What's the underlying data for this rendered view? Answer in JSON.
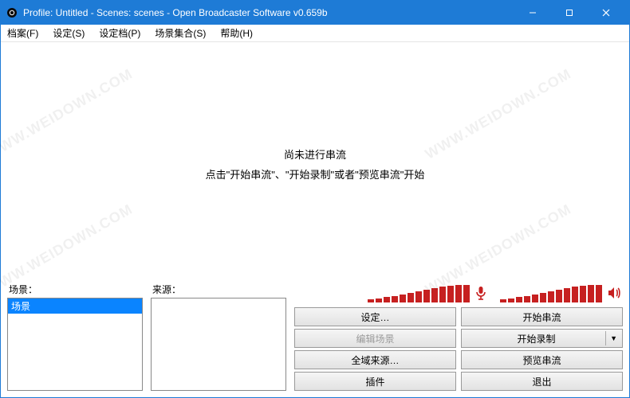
{
  "window": {
    "title": "Profile: Untitled - Scenes: scenes - Open Broadcaster Software v0.659b"
  },
  "menu": {
    "file": "档案(F)",
    "settings": "设定(S)",
    "profiles": "设定档(P)",
    "scene_collection": "场景集合(S)",
    "help": "帮助(H)"
  },
  "center": {
    "line1": "尚未进行串流",
    "line2": "点击\"开始串流\"、\"开始录制\"或者\"预览串流\"开始"
  },
  "panels": {
    "scenes_label": "场景：",
    "sources_label": "来源：",
    "scenes_items": [
      "场景"
    ]
  },
  "buttons": {
    "settings": "设定…",
    "edit_scene": "编辑场景",
    "global_sources": "全域来源…",
    "plugins": "插件",
    "start_stream": "开始串流",
    "start_record": "开始录制",
    "preview_stream": "预览串流",
    "exit": "退出"
  },
  "meters": {
    "mic_bars": [
      4,
      5,
      7,
      8,
      10,
      12,
      14,
      16,
      18,
      20,
      21,
      22,
      22
    ],
    "spk_bars": [
      4,
      5,
      7,
      8,
      10,
      12,
      14,
      16,
      18,
      20,
      21,
      22,
      22
    ]
  },
  "watermark": "WWW.WEIDOWN.COM"
}
